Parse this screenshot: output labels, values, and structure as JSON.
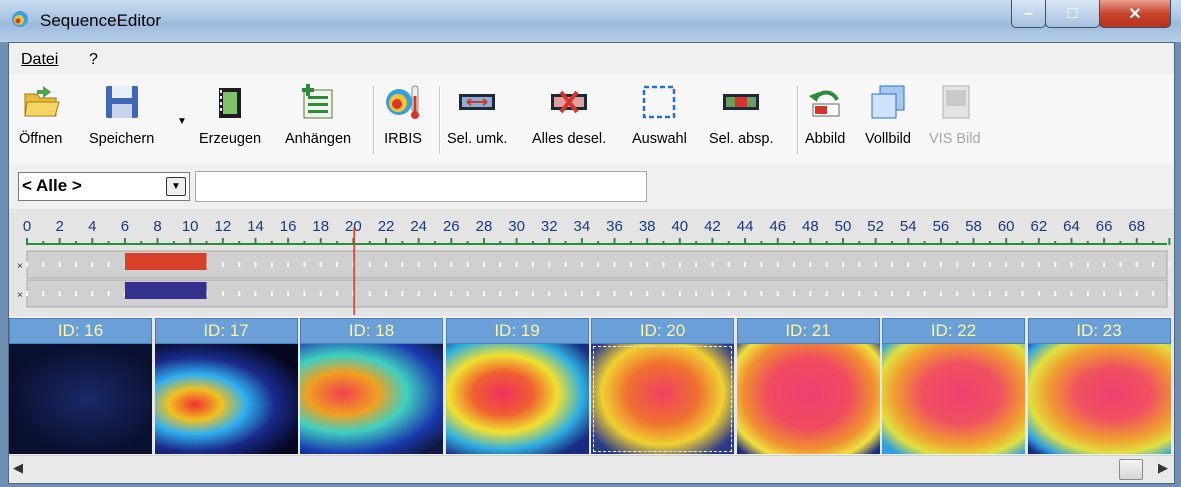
{
  "window": {
    "title": "SequenceEditor",
    "min": "–",
    "max": "□",
    "close": "✕"
  },
  "menu": [
    {
      "label": "Datei",
      "name": "menu-datei"
    },
    {
      "label": "?",
      "name": "menu-help"
    }
  ],
  "toolbar": [
    {
      "label": "Öffnen",
      "name": "open-button",
      "icon": "folder-open-icon"
    },
    {
      "label": "Speichern",
      "name": "save-button",
      "icon": "floppy-disk-icon"
    },
    {
      "label": "Erzeugen",
      "name": "create-button",
      "icon": "film-icon"
    },
    {
      "label": "Anhängen",
      "name": "append-button",
      "icon": "append-list-icon"
    },
    {
      "label": "IRBIS",
      "name": "irbis-button",
      "icon": "irbis-thermometer-icon"
    },
    {
      "label": "Sel. umk.",
      "name": "invert-selection-button",
      "icon": "invert-selection-icon"
    },
    {
      "label": "Alles desel.",
      "name": "deselect-all-button",
      "icon": "deselect-all-icon"
    },
    {
      "label": "Auswahl",
      "name": "selection-button",
      "icon": "dashed-selection-icon"
    },
    {
      "label": "Sel. absp.",
      "name": "play-selection-button",
      "icon": "play-selection-icon"
    },
    {
      "label": "Abbild",
      "name": "image-button",
      "icon": "image-undo-icon"
    },
    {
      "label": "Vollbild",
      "name": "fullscreen-button",
      "icon": "fullscreen-icon"
    },
    {
      "label": "VIS Bild",
      "name": "vis-image-button",
      "icon": "vis-image-icon",
      "disabled": true
    }
  ],
  "filter": {
    "selected": "< Alle >",
    "search_value": ""
  },
  "timeline": {
    "ticks": [
      "0",
      "2",
      "4",
      "6",
      "8",
      "10",
      "12",
      "14",
      "16",
      "18",
      "20",
      "22",
      "24",
      "26",
      "28",
      "30",
      "32",
      "34",
      "36",
      "38",
      "40",
      "42",
      "44",
      "46",
      "48",
      "50",
      "52",
      "54",
      "56",
      "58",
      "60",
      "62",
      "64",
      "66",
      "68"
    ],
    "cursor": 20,
    "tracks": [
      {
        "marker": "×",
        "start": 6,
        "end": 11,
        "color": "#d8402a"
      },
      {
        "marker": "×",
        "start": 6,
        "end": 11,
        "color": "#34308e"
      }
    ]
  },
  "thumbnails": [
    {
      "id": "ID: 16"
    },
    {
      "id": "ID: 17"
    },
    {
      "id": "ID: 18"
    },
    {
      "id": "ID: 19"
    },
    {
      "id": "ID: 20",
      "selected": true
    },
    {
      "id": "ID: 21"
    },
    {
      "id": "ID: 22"
    },
    {
      "id": "ID: 23"
    }
  ],
  "scrollbar": {
    "left_arrow": "◀",
    "right_arrow": "▶"
  }
}
